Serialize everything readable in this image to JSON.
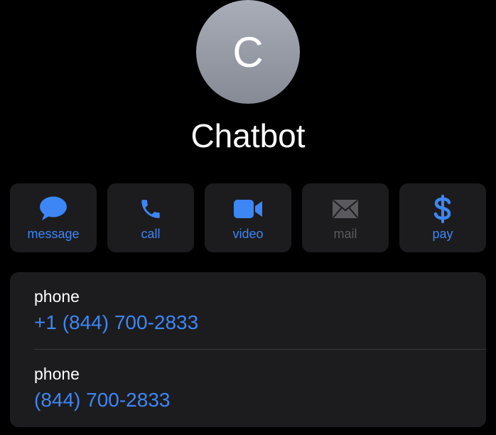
{
  "contact": {
    "avatar_initial": "C",
    "name": "Chatbot"
  },
  "actions": [
    {
      "label": "message",
      "icon": "message-bubble-icon",
      "enabled": true
    },
    {
      "label": "call",
      "icon": "phone-icon",
      "enabled": true
    },
    {
      "label": "video",
      "icon": "video-camera-icon",
      "enabled": true
    },
    {
      "label": "mail",
      "icon": "envelope-icon",
      "enabled": false
    },
    {
      "label": "pay",
      "icon": "dollar-icon",
      "enabled": true
    }
  ],
  "details": [
    {
      "label": "phone",
      "value": "+1 (844) 700-2833"
    },
    {
      "label": "phone",
      "value": "(844) 700-2833"
    }
  ],
  "colors": {
    "background": "#000000",
    "card": "#1c1c1e",
    "accent": "#3d86f5",
    "disabled": "#5a5a5e",
    "separator": "#38383a"
  }
}
